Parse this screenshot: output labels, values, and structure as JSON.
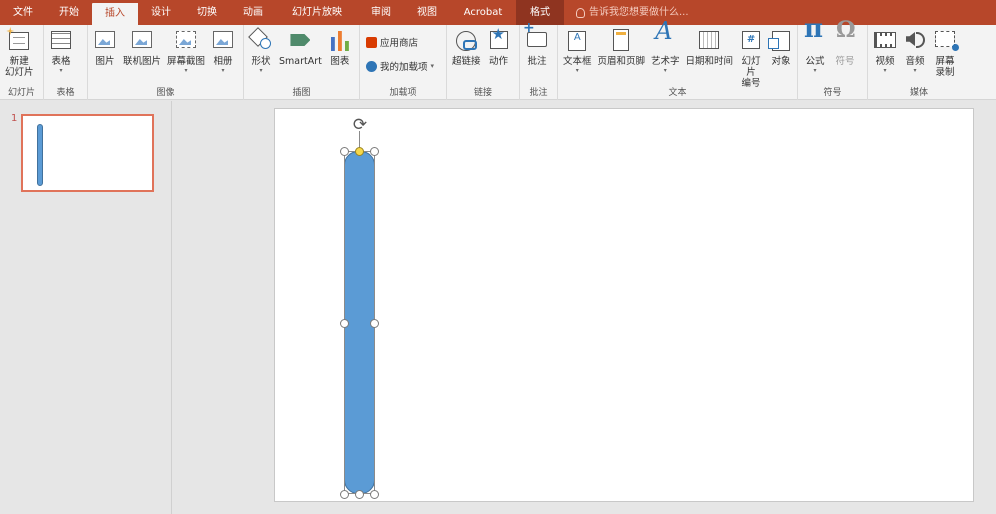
{
  "tabs": [
    "文件",
    "开始",
    "插入",
    "设计",
    "切换",
    "动画",
    "幻灯片放映",
    "审阅",
    "视图",
    "Acrobat",
    "格式"
  ],
  "tell_me": "告诉我您想要做什么...",
  "ribbon": {
    "new_slide": "新建\n幻灯片",
    "table": "表格",
    "picture": "图片",
    "online_picture": "联机图片",
    "screenshot": "屏幕截图",
    "album": "相册",
    "shapes": "形状",
    "smartart": "SmartArt",
    "chart": "图表",
    "store": "应用商店",
    "my_addins": "我的加载项",
    "hyperlink": "超链接",
    "action": "动作",
    "comment": "批注",
    "textbox": "文本框",
    "header_footer": "页眉和页脚",
    "wordart": "艺术字",
    "datetime": "日期和时间",
    "slide_number": "幻灯片\n编号",
    "object": "对象",
    "equation": "公式",
    "symbol": "符号",
    "video": "视频",
    "audio": "音频",
    "screen_recording": "屏幕\n录制"
  },
  "groups": {
    "slides": "幻灯片",
    "tables": "表格",
    "images": "图像",
    "illustrations": "插图",
    "addins": "加载项",
    "links": "链接",
    "comments": "批注",
    "text": "文本",
    "symbols": "符号",
    "media": "媒体"
  },
  "thumbnail": {
    "number": "1"
  },
  "colors": {
    "brand": "#b7472a",
    "shape_fill": "#5b9bd5",
    "shape_border": "#41719c",
    "thumb_border": "#e0735a"
  }
}
